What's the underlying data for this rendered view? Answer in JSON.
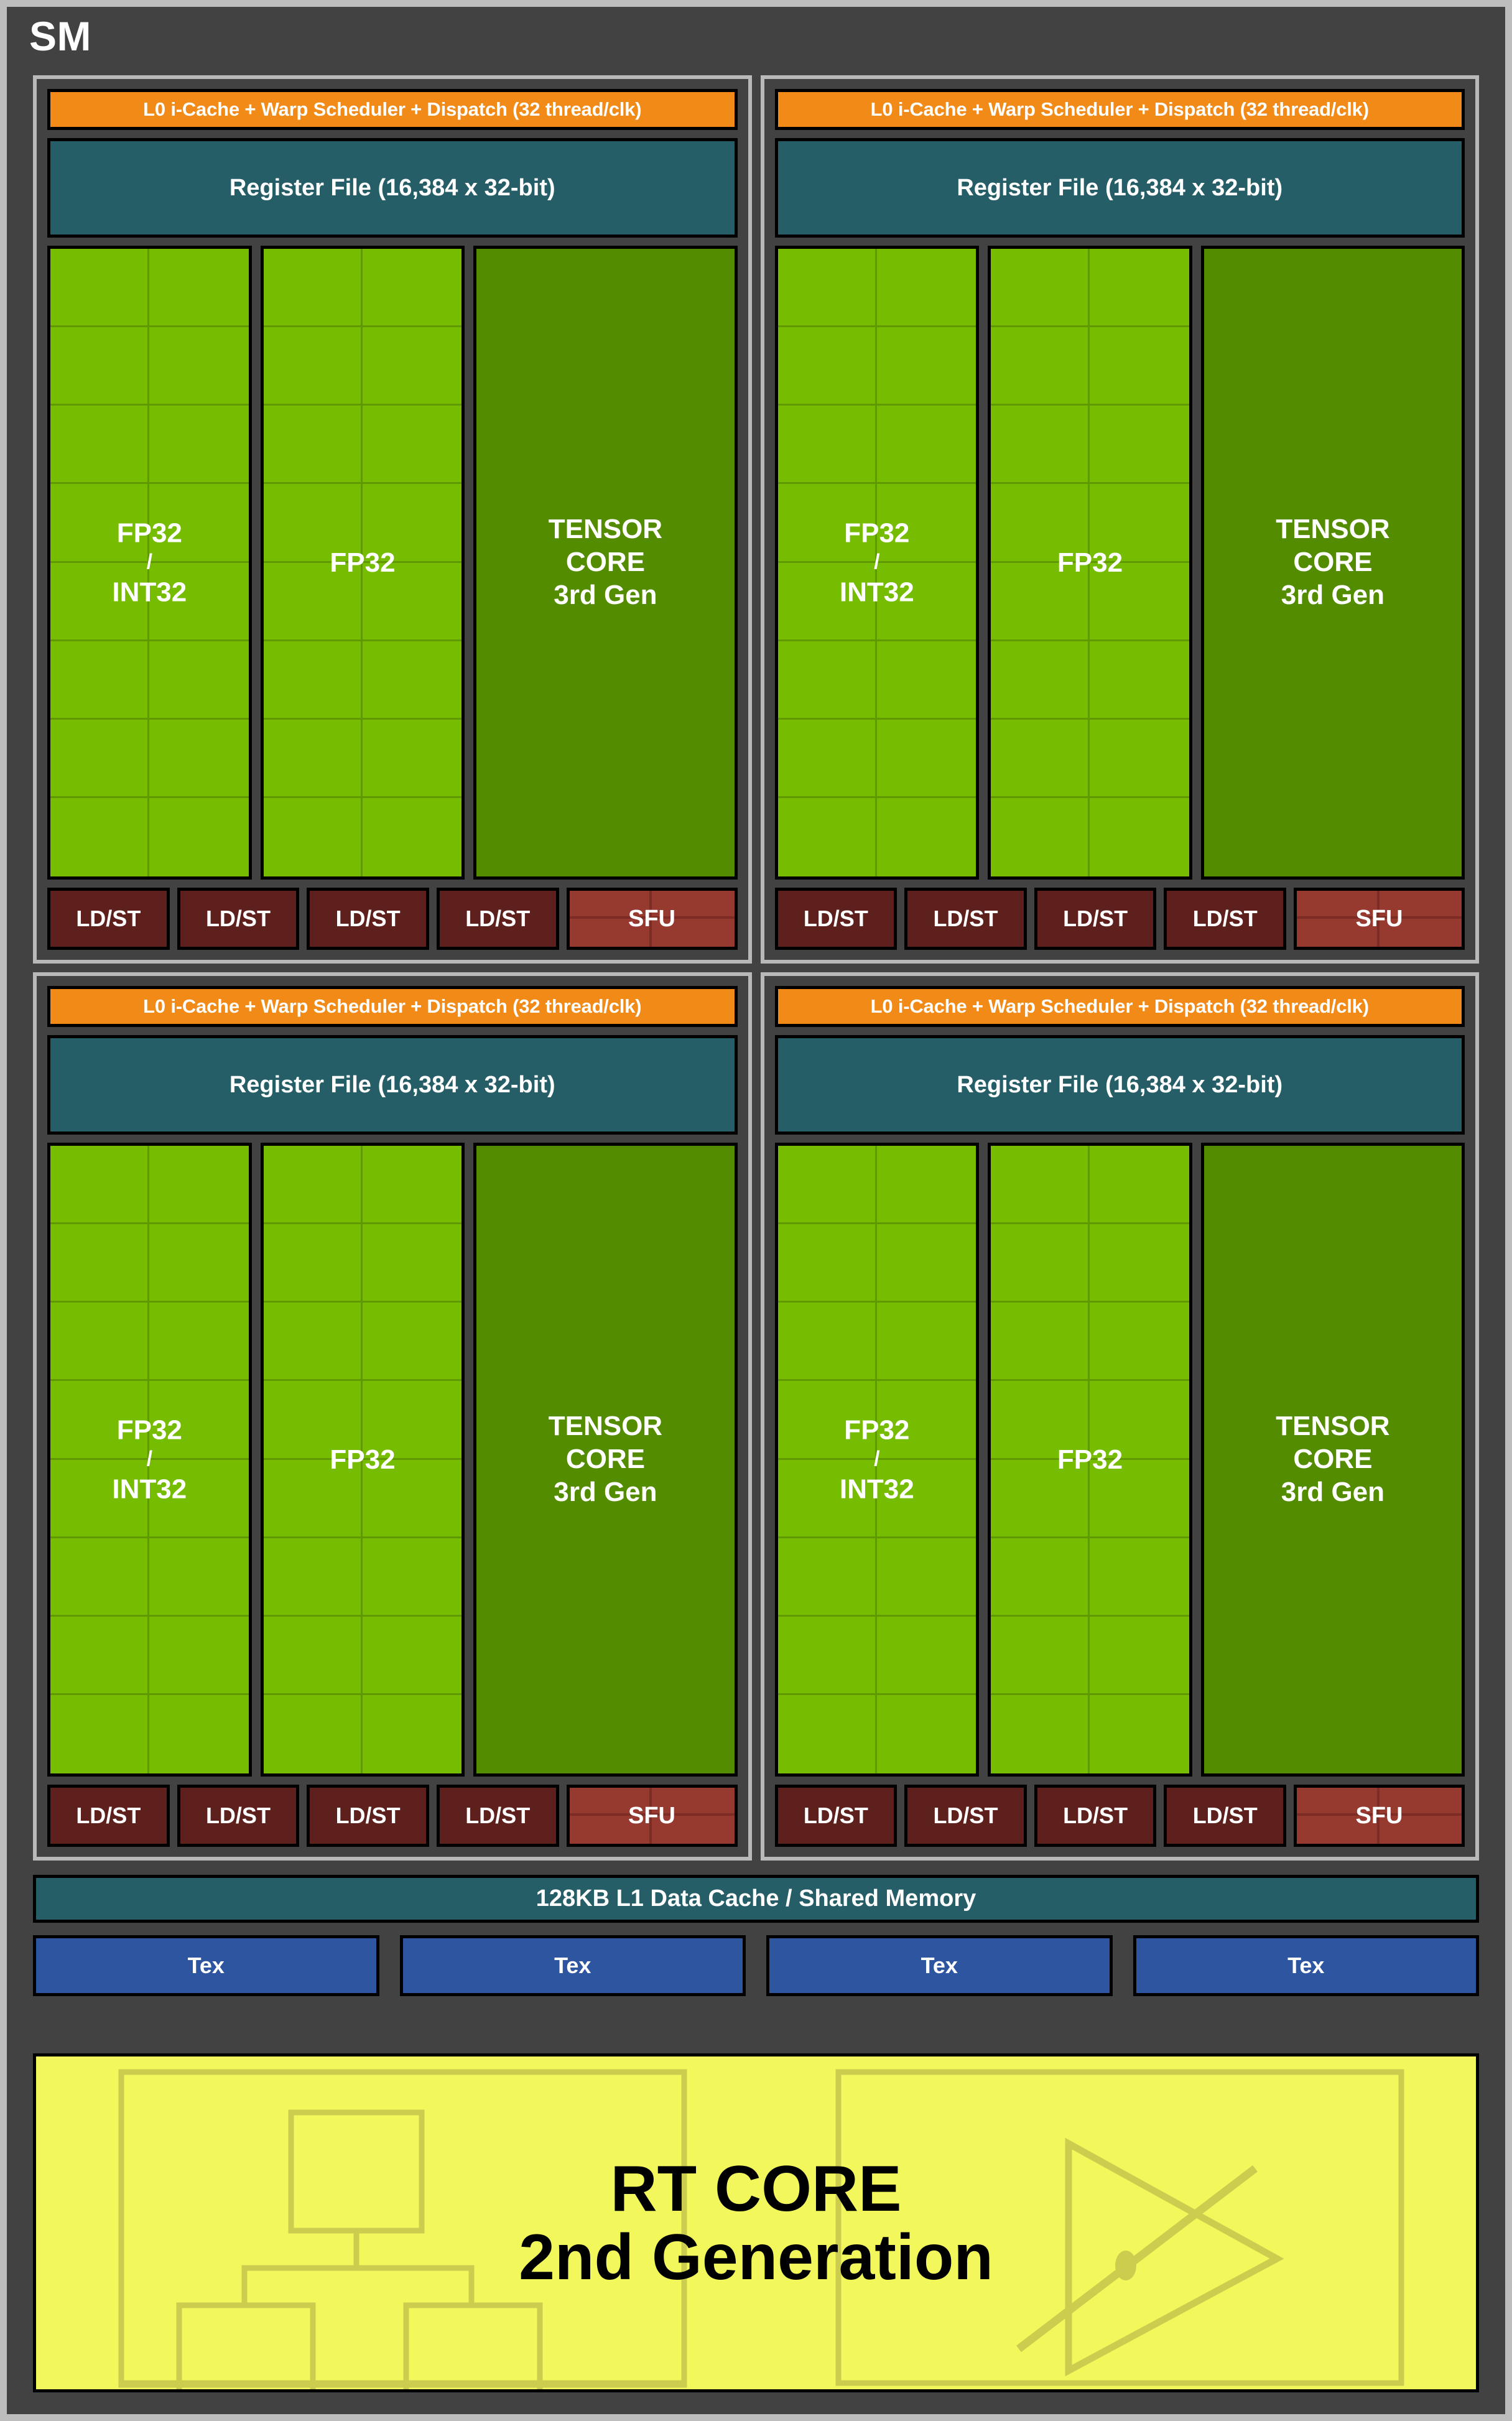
{
  "diagram": {
    "title": "SM",
    "colors": {
      "background": "#424242",
      "outer_border": "#bdbdbd",
      "scheduler_orange": "#f18a17",
      "register_teal": "#265e68",
      "fp32_green": "#76bc00",
      "tensor_green": "#548c00",
      "ldst_red": "#5e201c",
      "sfu_red": "#963a30",
      "tex_blue": "#2d55a0",
      "rt_yellow": "#f2f75c"
    }
  },
  "processing_blocks": [
    {
      "scheduler": "L0 i-Cache + Warp Scheduler + Dispatch (32 thread/clk)",
      "register_file": "Register File (16,384 x 32-bit)",
      "fp32_blocks": [
        {
          "line1": "FP32",
          "slash": "/",
          "line2": "INT32"
        },
        {
          "line1": "FP32",
          "slash": "",
          "line2": ""
        }
      ],
      "tensor_core": {
        "line1": "TENSOR",
        "line2": "CORE",
        "line3": "3rd Gen"
      },
      "ldst": [
        "LD/ST",
        "LD/ST",
        "LD/ST",
        "LD/ST"
      ],
      "sfu": "SFU"
    },
    {
      "scheduler": "L0 i-Cache + Warp Scheduler + Dispatch (32 thread/clk)",
      "register_file": "Register File (16,384 x 32-bit)",
      "fp32_blocks": [
        {
          "line1": "FP32",
          "slash": "/",
          "line2": "INT32"
        },
        {
          "line1": "FP32",
          "slash": "",
          "line2": ""
        }
      ],
      "tensor_core": {
        "line1": "TENSOR",
        "line2": "CORE",
        "line3": "3rd Gen"
      },
      "ldst": [
        "LD/ST",
        "LD/ST",
        "LD/ST",
        "LD/ST"
      ],
      "sfu": "SFU"
    },
    {
      "scheduler": "L0 i-Cache + Warp Scheduler + Dispatch (32 thread/clk)",
      "register_file": "Register File (16,384 x 32-bit)",
      "fp32_blocks": [
        {
          "line1": "FP32",
          "slash": "/",
          "line2": "INT32"
        },
        {
          "line1": "FP32",
          "slash": "",
          "line2": ""
        }
      ],
      "tensor_core": {
        "line1": "TENSOR",
        "line2": "CORE",
        "line3": "3rd Gen"
      },
      "ldst": [
        "LD/ST",
        "LD/ST",
        "LD/ST",
        "LD/ST"
      ],
      "sfu": "SFU"
    },
    {
      "scheduler": "L0 i-Cache + Warp Scheduler + Dispatch (32 thread/clk)",
      "register_file": "Register File (16,384 x 32-bit)",
      "fp32_blocks": [
        {
          "line1": "FP32",
          "slash": "/",
          "line2": "INT32"
        },
        {
          "line1": "FP32",
          "slash": "",
          "line2": ""
        }
      ],
      "tensor_core": {
        "line1": "TENSOR",
        "line2": "CORE",
        "line3": "3rd Gen"
      },
      "ldst": [
        "LD/ST",
        "LD/ST",
        "LD/ST",
        "LD/ST"
      ],
      "sfu": "SFU"
    }
  ],
  "l1_cache": "128KB L1 Data Cache / Shared Memory",
  "tex_units": [
    "Tex",
    "Tex",
    "Tex",
    "Tex"
  ],
  "rt_core": {
    "line1": "RT CORE",
    "line2": "2nd Generation",
    "icons": [
      "bvh-tree-icon",
      "ray-triangle-intersection-icon"
    ]
  }
}
